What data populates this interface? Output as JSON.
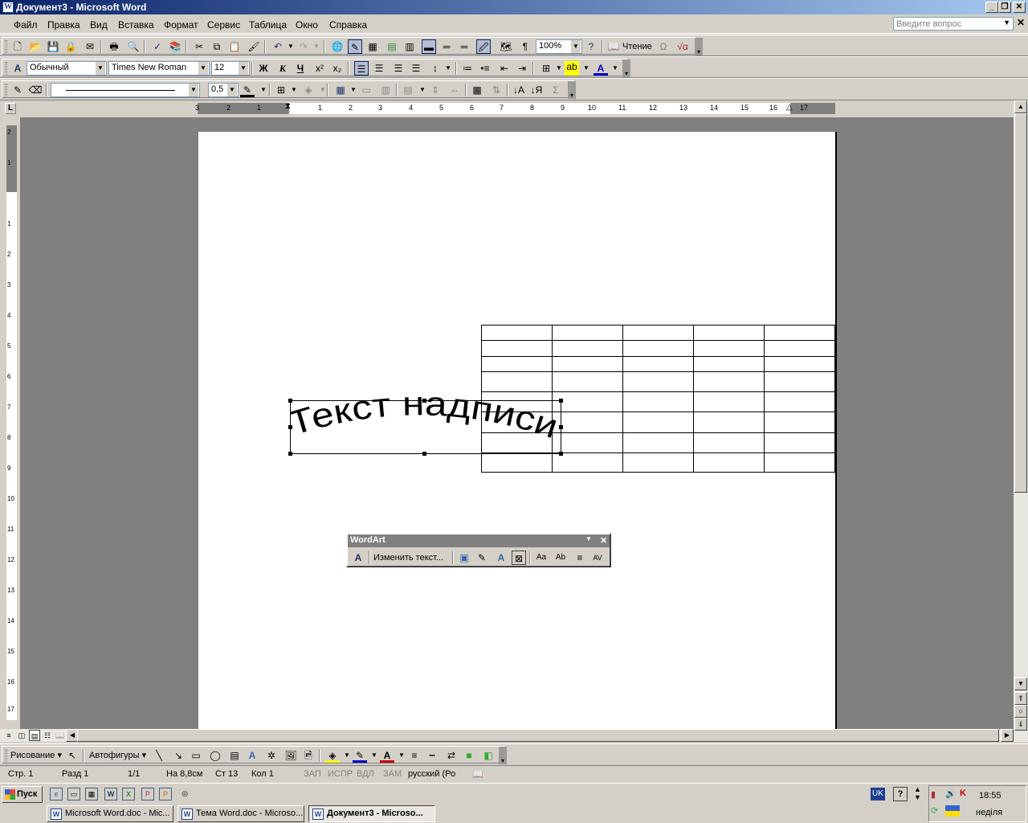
{
  "window": {
    "title": "Документ3 - Microsoft Word",
    "minimize": "_",
    "restore": "❐",
    "close": "✕"
  },
  "menu": {
    "items": [
      "Файл",
      "Правка",
      "Вид",
      "Вставка",
      "Формат",
      "Сервис",
      "Таблица",
      "Окно",
      "Справка"
    ],
    "ask_placeholder": "Введите вопрос",
    "close_doc": "✕"
  },
  "standard_toolbar": {
    "zoom": "100%",
    "reading": "Чтение",
    "omega": "Ω"
  },
  "format_toolbar": {
    "style": "Обычный",
    "font": "Times New Roman",
    "size": "12",
    "bold": "Ж",
    "italic": "К",
    "underline": "Ч"
  },
  "tables_toolbar": {
    "line_weight": "0,5"
  },
  "ruler": {
    "h_numbers": [
      "3",
      "2",
      "1",
      "1",
      "2",
      "3",
      "4",
      "5",
      "6",
      "7",
      "8",
      "9",
      "10",
      "11",
      "12",
      "13",
      "14",
      "15",
      "16",
      "17"
    ],
    "v_numbers": [
      "2",
      "1",
      "1",
      "2",
      "3",
      "4",
      "5",
      "6",
      "7",
      "8",
      "9",
      "10",
      "11",
      "12",
      "13",
      "14",
      "15",
      "16",
      "17"
    ]
  },
  "document": {
    "table": {
      "rows": 8,
      "cols": 5
    },
    "wordart_text": "Текст надписи"
  },
  "wordart_toolbar": {
    "title": "WordArt",
    "edit_text": "Изменить текст...",
    "icons": [
      "wordart-insert-icon",
      "gallery-icon",
      "format-wordart-icon",
      "shape-icon",
      "wrap-icon",
      "same-letter-heights-icon",
      "vertical-text-icon",
      "alignment-icon",
      "char-spacing-icon"
    ]
  },
  "drawing_toolbar": {
    "drawing": "Рисование",
    "autoshapes": "Автофигуры"
  },
  "status": {
    "page": "Стр.  1",
    "section": "Разд  1",
    "pages": "1/1",
    "at": "На  8,8см",
    "line": "Ст  13",
    "col": "Кол  1",
    "rec": "ЗАП",
    "trk": "ИСПР",
    "ext": "ВДЛ",
    "ovr": "ЗАМ",
    "lang": "русский (Ро"
  },
  "taskbar": {
    "start": "Пуск",
    "buttons": [
      "Microsoft Word.doc - Mic...",
      "Тема Word.doc - Microso...",
      "Документ3 - Microso..."
    ],
    "lang": "UK",
    "time": "18:55",
    "day": "неділя"
  }
}
